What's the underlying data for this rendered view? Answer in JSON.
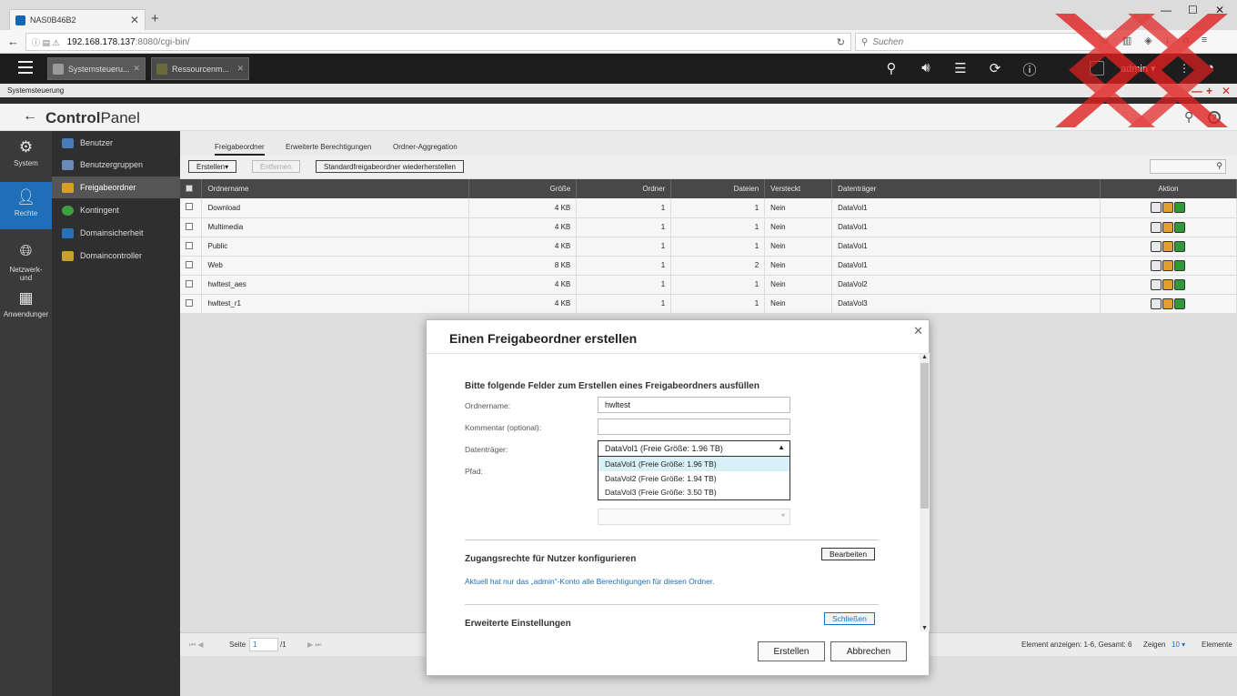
{
  "browser": {
    "tab_title": "NAS0B46B2",
    "url_host": "192.168.178.137",
    "url_path": ":8080/cgi-bin/",
    "search_placeholder": "Suchen"
  },
  "qnap": {
    "app_tabs": [
      "Systemsteueru...",
      "Ressourcenm..."
    ],
    "user": "admin"
  },
  "window": {
    "title": "Systemsteuerung",
    "panel_title_bold": "Control",
    "panel_title_rest": "Panel"
  },
  "rail": [
    {
      "label": "System"
    },
    {
      "label": "Rechte"
    },
    {
      "label": "Netzwerk-\nund"
    },
    {
      "label": "Anwendunger"
    }
  ],
  "sidebar": {
    "items": [
      {
        "label": "Benutzer",
        "color": "#4a7ab8"
      },
      {
        "label": "Benutzergruppen",
        "color": "#6a8ab8"
      },
      {
        "label": "Freigabeordner",
        "color": "#d9a020"
      },
      {
        "label": "Kontingent",
        "color": "#3ca040"
      },
      {
        "label": "Domainsicherheit",
        "color": "#2a70b8"
      },
      {
        "label": "Domaincontroller",
        "color": "#c8a030"
      }
    ]
  },
  "content_tabs": [
    "Freigabeordner",
    "Erweiterte Berechtigungen",
    "Ordner-Aggregation"
  ],
  "toolbar": {
    "create": "Erstellen",
    "remove": "Entfernen",
    "restore": "Standardfreigabeordner wiederherstellen"
  },
  "table": {
    "headers": [
      "Ordnername",
      "Größe",
      "Ordner",
      "Dateien",
      "Versteckt",
      "Datenträger",
      "Aktion"
    ],
    "rows": [
      {
        "name": "Download",
        "size": "4 KB",
        "folders": "1",
        "files": "1",
        "hidden": "Nein",
        "volume": "DataVol1"
      },
      {
        "name": "Multimedia",
        "size": "4 KB",
        "folders": "1",
        "files": "1",
        "hidden": "Nein",
        "volume": "DataVol1"
      },
      {
        "name": "Public",
        "size": "4 KB",
        "folders": "1",
        "files": "1",
        "hidden": "Nein",
        "volume": "DataVol1"
      },
      {
        "name": "Web",
        "size": "8 KB",
        "folders": "1",
        "files": "2",
        "hidden": "Nein",
        "volume": "DataVol1"
      },
      {
        "name": "hwltest_aes",
        "size": "4 KB",
        "folders": "1",
        "files": "1",
        "hidden": "Nein",
        "volume": "DataVol2"
      },
      {
        "name": "hwltest_r1",
        "size": "4 KB",
        "folders": "1",
        "files": "1",
        "hidden": "Nein",
        "volume": "DataVol3"
      }
    ]
  },
  "footer": {
    "page_label": "Seite",
    "page_value": "1",
    "page_total": "/1",
    "info": "Element anzeigen: 1-6, Gesamt: 6",
    "show_label": "Zeigen",
    "show_value": "10",
    "items_label": "Elemente"
  },
  "dialog": {
    "title": "Einen Freigabeordner erstellen",
    "intro": "Bitte folgende Felder zum Erstellen eines Freigabeordners ausfüllen",
    "folder_label": "Ordnername:",
    "folder_value": "hwltest",
    "comment_label": "Kommentar (optional):",
    "comment_value": "",
    "volume_label": "Datenträger:",
    "volume_value": "DataVol1 (Freie Größe: 1.96 TB)",
    "volume_options": [
      "DataVol1 (Freie Größe: 1.96 TB)",
      "DataVol2 (Freie Größe: 1.94 TB)",
      "DataVol3 (Freie Größe: 3.50 TB)"
    ],
    "path_label": "Pfad:",
    "access_head": "Zugangsrechte für Nutzer konfigurieren",
    "edit_btn": "Bearbeiten",
    "access_text": "Aktuell hat nur das „admin“-Konto alle Berechtigungen für diesen Ordner.",
    "advanced_head": "Erweiterte Einstellungen",
    "close_btn": "Schließen",
    "create_btn": "Erstellen",
    "cancel_btn": "Abbrechen"
  }
}
